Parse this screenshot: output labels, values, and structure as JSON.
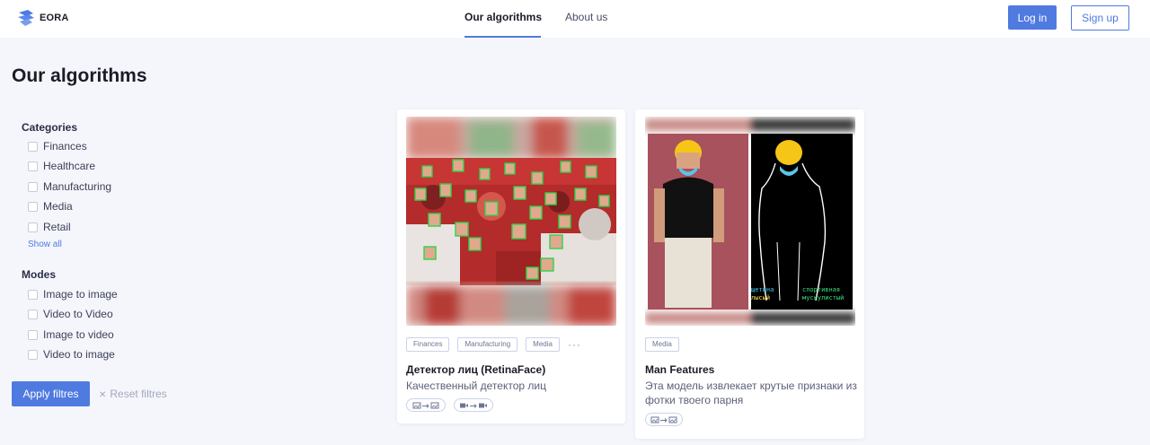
{
  "header": {
    "logo_text": "EORA",
    "nav": [
      {
        "label": "Our algorithms"
      },
      {
        "label": "About us"
      }
    ],
    "login_label": "Log in",
    "signup_label": "Sign up",
    "accent_color": "#4f7ae0"
  },
  "page": {
    "title": "Our algorithms"
  },
  "filters": {
    "categories_heading": "Categories",
    "categories": [
      "Finances",
      "Healthcare",
      "Manufacturing",
      "Media",
      "Retail"
    ],
    "show_all_label": "Show all",
    "modes_heading": "Modes",
    "modes": [
      "Image to image",
      "Video to Video",
      "Image to video",
      "Video to image"
    ],
    "apply_label": "Apply filtres",
    "reset_label": "Reset filtres"
  },
  "cards": [
    {
      "tags": [
        "Finances",
        "Manufacturing",
        "Media"
      ],
      "has_more_tags": true,
      "title": "Детектор лиц (RetinaFace)",
      "description": "Качественный детектор лиц",
      "modes": [
        "image-to-image",
        "video-to-video"
      ]
    },
    {
      "tags": [
        "Media"
      ],
      "title": "Man Features",
      "description": "Эта модель извлекает крутые признаки из фотки твоего парня",
      "image_labels": [
        {
          "text": "щетина",
          "color": "#3ad0ff"
        },
        {
          "text": "спортивная",
          "color": "#39e07a"
        },
        {
          "text": "лысый",
          "color": "#ffe14a"
        },
        {
          "text": "мускулистый",
          "color": "#39e07a"
        }
      ],
      "modes": [
        "image-to-image"
      ]
    }
  ]
}
